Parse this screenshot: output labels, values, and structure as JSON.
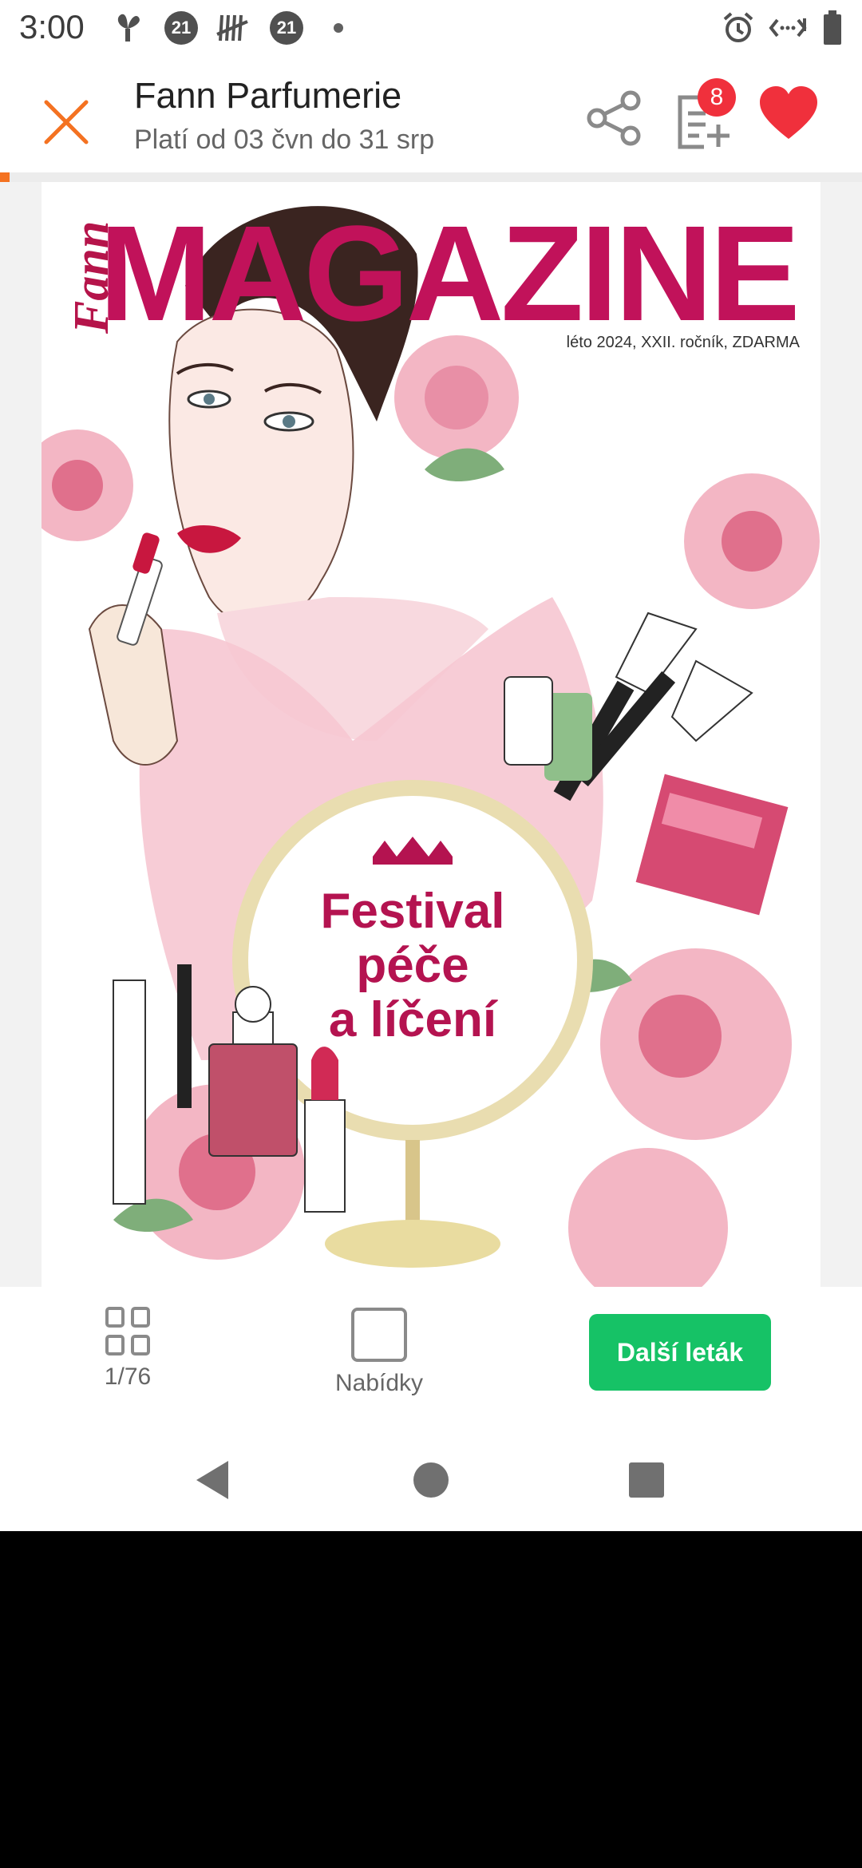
{
  "status_bar": {
    "time": "3:00",
    "badge_left": "21",
    "badge_right": "21",
    "icons": [
      "fan-icon",
      "badge-21-icon",
      "tally-icon",
      "badge-21-icon",
      "dot-icon",
      "alarm-icon",
      "data-icon",
      "battery-icon"
    ]
  },
  "header": {
    "title": "Fann Parfumerie",
    "subtitle": "Platí od 03 čvn do 31 srp",
    "list_badge": "8",
    "accent_color": "#f47221",
    "heart_color": "#f0303c"
  },
  "magazine": {
    "brand": "Fann",
    "title": "MAGAZINE",
    "edition": "léto 2024, XXII. ročník, ZDARMA",
    "headline_lines": [
      "Festival",
      "péče",
      "a líčení"
    ],
    "brand_color": "#c1125a"
  },
  "toolbar": {
    "page_counter": "1/76",
    "offers_label": "Nabídky",
    "next_button_label": "Další leták",
    "next_button_color": "#16c266"
  }
}
